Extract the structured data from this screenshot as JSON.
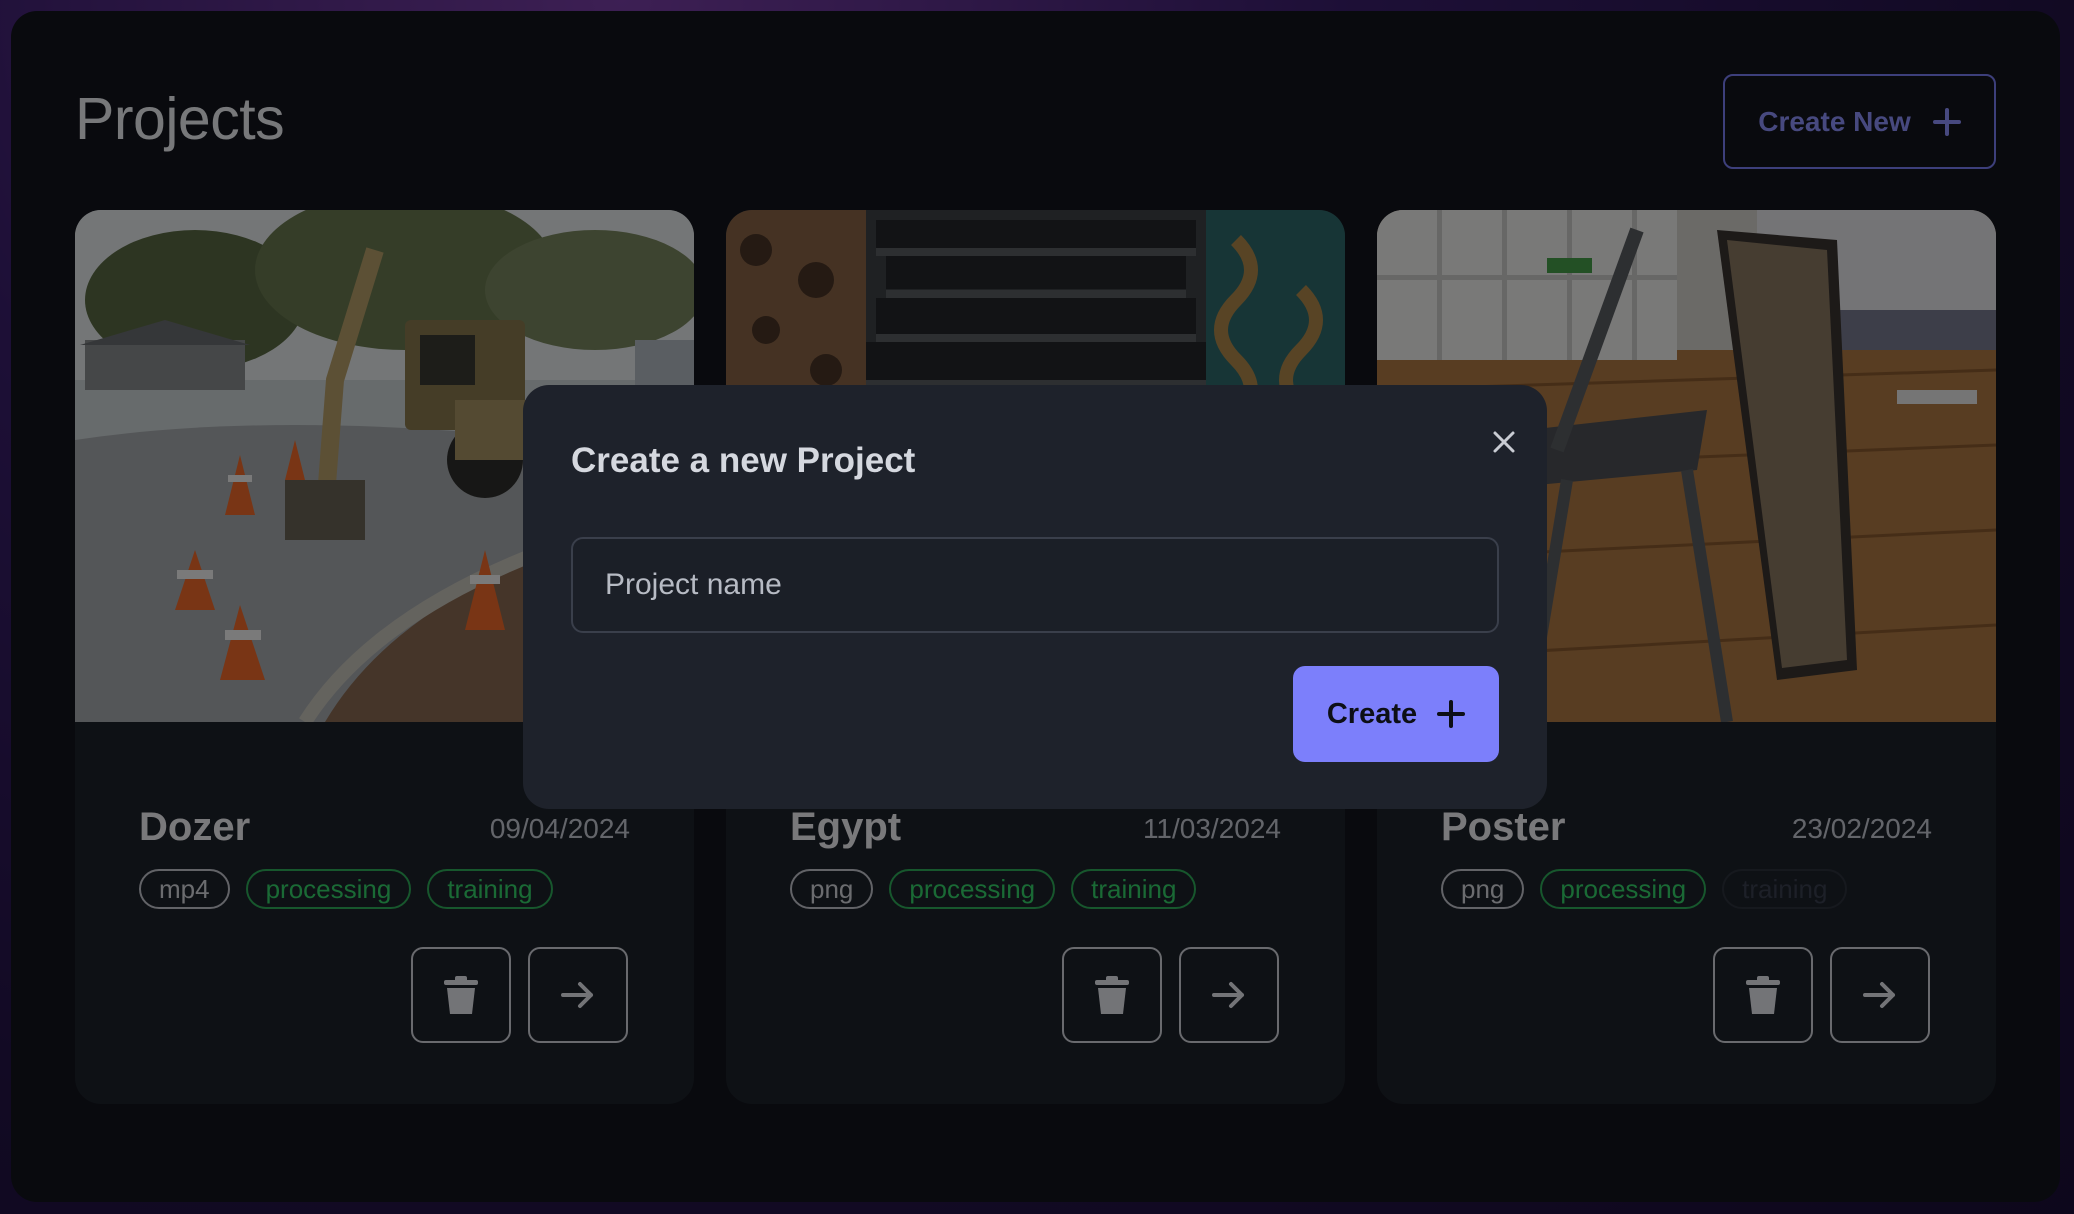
{
  "header": {
    "title": "Projects",
    "create_new_label": "Create New"
  },
  "projects": [
    {
      "name": "Dozer",
      "date": "09/04/2024",
      "tags": [
        "mp4",
        "processing",
        "training"
      ],
      "image": "construction-site-backhoe-photo"
    },
    {
      "name": "Egypt",
      "date": "11/03/2024",
      "tags": [
        "png",
        "processing",
        "training"
      ],
      "image": "outdoor-staircase-photo"
    },
    {
      "name": "Poster",
      "date": "23/02/2024",
      "tags": [
        "png",
        "processing",
        "training"
      ],
      "image": "bedroom-chair-poster-photo"
    }
  ],
  "modal": {
    "title": "Create a new Project",
    "input_placeholder": "Project name",
    "input_value": "",
    "create_label": "Create"
  },
  "colors": {
    "accent": "#7c7ffb",
    "success": "#34d46a",
    "background": "#12151c",
    "card": "#1d222b"
  }
}
